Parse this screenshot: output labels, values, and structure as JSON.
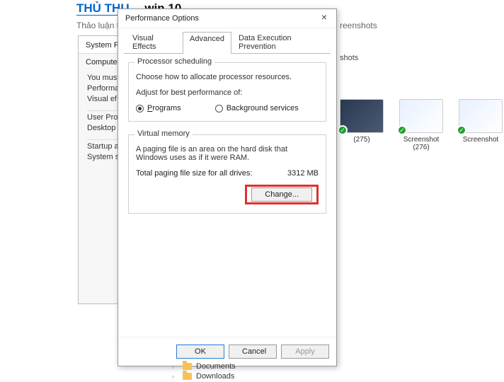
{
  "background": {
    "title_prefix": "THỦ THU…",
    "title_suffix": "win 10",
    "subtitle_left": "Thảo luận tron",
    "subtitle_right": "reenshots",
    "shots_label": "shots"
  },
  "thumbs": [
    {
      "label": "(275)"
    },
    {
      "label": "Screenshot (276)"
    },
    {
      "label": "Screenshot"
    }
  ],
  "sysprop": {
    "title": "System Prope",
    "tab": "Computer Na",
    "lines": [
      "You must b",
      "Performan",
      "Visual ef"
    ],
    "group2": [
      "User Profi",
      "Desktop s"
    ],
    "group3": [
      "Startup an",
      "System s"
    ]
  },
  "dialog": {
    "title": "Performance Options",
    "tabs": [
      "Visual Effects",
      "Advanced",
      "Data Execution Prevention"
    ],
    "active_tab": 1,
    "proc": {
      "title": "Processor scheduling",
      "desc": "Choose how to allocate processor resources.",
      "adjust_label": "Adjust for best performance of:",
      "opt_programs_prefix": "P",
      "opt_programs_rest": "rograms",
      "opt_bg": "Background services",
      "selected": "programs"
    },
    "vm": {
      "title": "Virtual memory",
      "desc": "A paging file is an area on the hard disk that Windows uses as if it were RAM.",
      "total_label": "Total paging file size for all drives:",
      "total_value": "3312 MB",
      "change_label": "Change..."
    },
    "buttons": {
      "ok": "OK",
      "cancel": "Cancel",
      "apply": "Apply"
    }
  },
  "nav": {
    "documents": "Documents",
    "downloads": "Downloads"
  }
}
